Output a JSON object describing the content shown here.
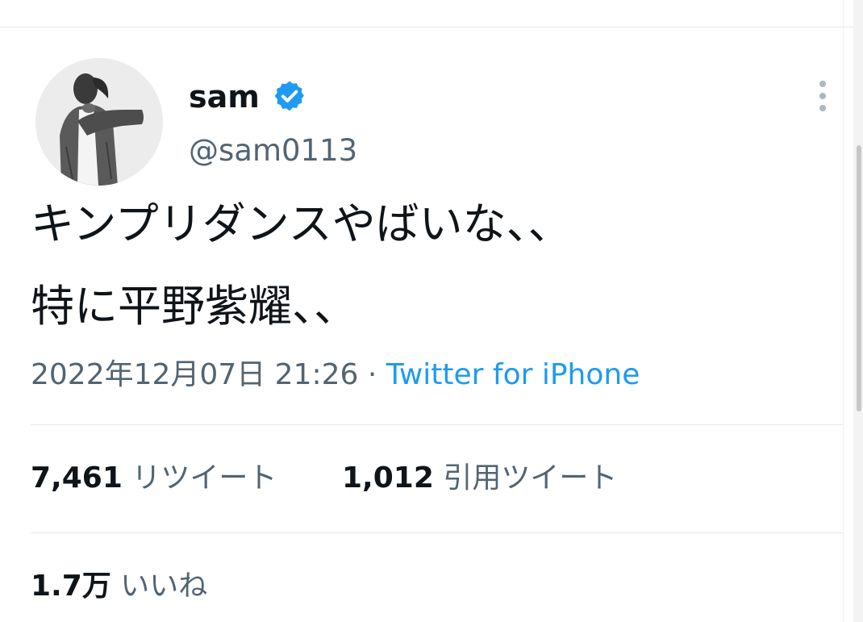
{
  "user": {
    "display_name": "sam",
    "handle": "@sam0113",
    "verified": true
  },
  "tweet": {
    "lines": [
      "キンプリダンスやばいな、、",
      "特に平野紫耀、、"
    ],
    "timestamp": "2022年12月07日 21:26",
    "separator": "·",
    "source": "Twitter for iPhone"
  },
  "stats": {
    "retweets_count": "7,461",
    "retweets_label": "リツイート",
    "quotes_count": "1,012",
    "quotes_label": "引用ツイート",
    "likes_count": "1.7万",
    "likes_label": "いいね"
  },
  "icons": {
    "verified": "verified-badge-icon",
    "more": "more-options-icon"
  },
  "colors": {
    "accent": "#1d9bf0",
    "text_primary": "#0f1419",
    "text_secondary": "#536471",
    "divider": "#e4e7ea"
  }
}
